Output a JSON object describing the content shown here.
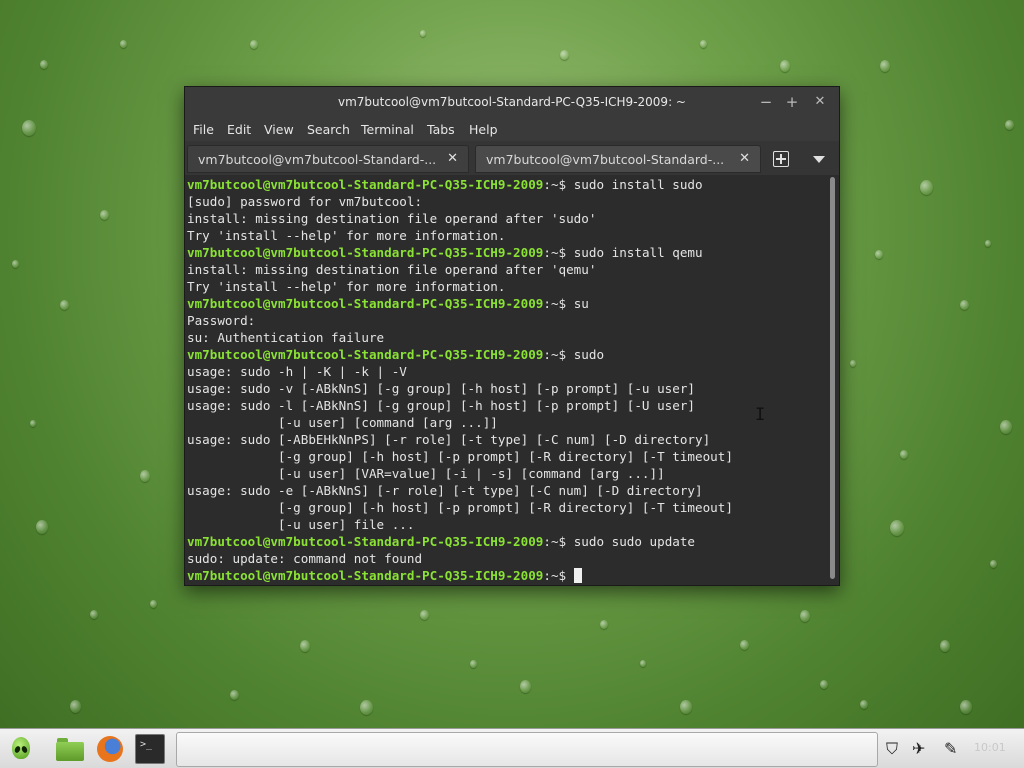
{
  "window": {
    "title": "vm7butcool@vm7butcool-Standard-PC-Q35-ICH9-2009: ~",
    "minimize": "−",
    "maximize": "+",
    "close": "✕"
  },
  "menubar": [
    "File",
    "Edit",
    "View",
    "Search",
    "Terminal",
    "Tabs",
    "Help"
  ],
  "tabs": [
    {
      "label": "vm7butcool@vm7butcool-Standard-...",
      "close": "✕"
    },
    {
      "label": "vm7butcool@vm7butcool-Standard-...",
      "close": "✕"
    }
  ],
  "terminal": {
    "prompt": "vm7butcool@vm7butcool-Standard-PC-Q35-ICH9-2009",
    "prompt_suffix": ":~$ ",
    "lines": [
      {
        "is_prompt": true,
        "text": "sudo install sudo"
      },
      {
        "is_prompt": false,
        "text": "[sudo] password for vm7butcool:"
      },
      {
        "is_prompt": false,
        "text": "install: missing destination file operand after 'sudo'"
      },
      {
        "is_prompt": false,
        "text": "Try 'install --help' for more information."
      },
      {
        "is_prompt": true,
        "text": "sudo install qemu"
      },
      {
        "is_prompt": false,
        "text": "install: missing destination file operand after 'qemu'"
      },
      {
        "is_prompt": false,
        "text": "Try 'install --help' for more information."
      },
      {
        "is_prompt": true,
        "text": "su"
      },
      {
        "is_prompt": false,
        "text": "Password:"
      },
      {
        "is_prompt": false,
        "text": "su: Authentication failure"
      },
      {
        "is_prompt": true,
        "text": "sudo"
      },
      {
        "is_prompt": false,
        "text": "usage: sudo -h | -K | -k | -V"
      },
      {
        "is_prompt": false,
        "text": "usage: sudo -v [-ABkNnS] [-g group] [-h host] [-p prompt] [-u user]"
      },
      {
        "is_prompt": false,
        "text": "usage: sudo -l [-ABkNnS] [-g group] [-h host] [-p prompt] [-U user]"
      },
      {
        "is_prompt": false,
        "text": "            [-u user] [command [arg ...]]"
      },
      {
        "is_prompt": false,
        "text": "usage: sudo [-ABbEHkNnPS] [-r role] [-t type] [-C num] [-D directory]"
      },
      {
        "is_prompt": false,
        "text": "            [-g group] [-h host] [-p prompt] [-R directory] [-T timeout]"
      },
      {
        "is_prompt": false,
        "text": "            [-u user] [VAR=value] [-i | -s] [command [arg ...]]"
      },
      {
        "is_prompt": false,
        "text": "usage: sudo -e [-ABkNnS] [-r role] [-t type] [-C num] [-D directory]"
      },
      {
        "is_prompt": false,
        "text": "            [-g group] [-h host] [-p prompt] [-R directory] [-T timeout]"
      },
      {
        "is_prompt": false,
        "text": "            [-u user] file ..."
      },
      {
        "is_prompt": true,
        "text": "sudo sudo update"
      },
      {
        "is_prompt": false,
        "text": "sudo: update: command not found"
      },
      {
        "is_prompt": true,
        "text": "",
        "cursor": true
      }
    ]
  },
  "taskbar": {
    "launchers": [
      "menu-icon",
      "folder-icon",
      "firefox-icon",
      "terminal-icon"
    ],
    "terminal_glyph": ">_",
    "tray": {
      "shield": "⛉",
      "network": "✈",
      "sound": "✎"
    },
    "clock": "10:01"
  },
  "colors": {
    "prompt": "#8ae234",
    "terminal_bg": "#2c2c2c",
    "terminal_fg": "#e4e4e4"
  }
}
